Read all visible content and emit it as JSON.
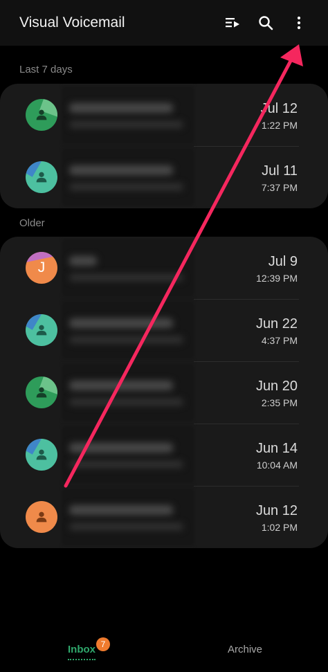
{
  "app": {
    "title": "Visual Voicemail"
  },
  "toolbar": {
    "icons": [
      "playlist-play-icon",
      "search-icon",
      "more-vert-icon"
    ]
  },
  "sections": [
    {
      "label": "Last 7 days",
      "items": [
        {
          "date": "Jul 12",
          "time": "1:22 PM",
          "avatar_color": "#2e9c5a",
          "avatar_accent": "#6cc38a"
        },
        {
          "date": "Jul 11",
          "time": "7:37 PM",
          "avatar_color": "#4dc0a0",
          "avatar_accent": "#3f86c8"
        }
      ]
    },
    {
      "label": "Older",
      "items": [
        {
          "date": "Jul 9",
          "time": "12:39 PM",
          "avatar_letter": "J",
          "avatar_color": "#f08a4a",
          "avatar_accent": "#c06fc2"
        },
        {
          "date": "Jun 22",
          "time": "4:37 PM",
          "avatar_color": "#4dc0a0",
          "avatar_accent": "#3f86c8"
        },
        {
          "date": "Jun 20",
          "time": "2:35 PM",
          "avatar_color": "#2e9c5a",
          "avatar_accent": "#6cc38a"
        },
        {
          "date": "Jun 14",
          "time": "10:04 AM",
          "avatar_color": "#4dc0a0",
          "avatar_accent": "#3f86c8"
        },
        {
          "date": "Jun 12",
          "time": "1:02 PM",
          "avatar_color": "#f08a4a",
          "avatar_accent": "#f5a76a"
        }
      ]
    }
  ],
  "bottom_nav": {
    "inbox_label": "Inbox",
    "inbox_badge": "7",
    "archive_label": "Archive",
    "active_color": "#2fa86c"
  },
  "annotation": {
    "arrow_color": "#f5275e"
  }
}
